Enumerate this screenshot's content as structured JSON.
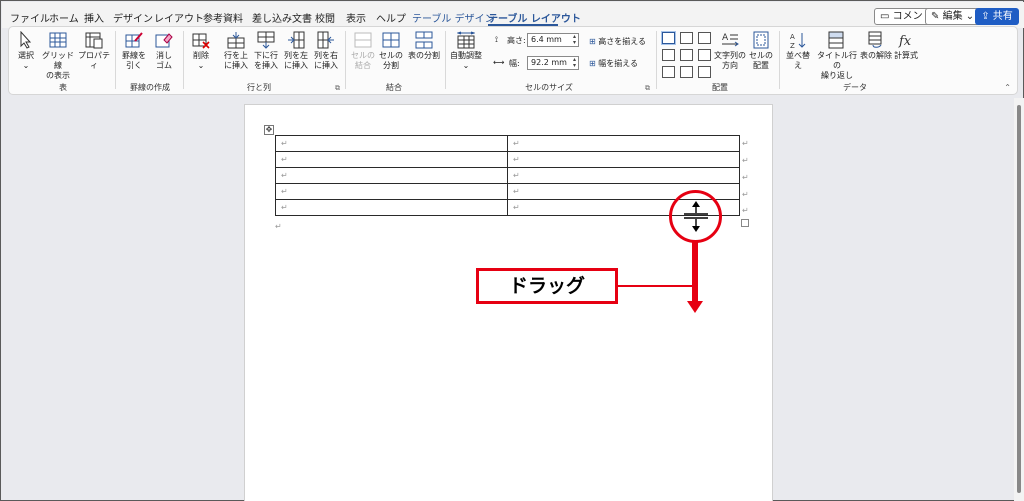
{
  "tabs": [
    "ファイル",
    "ホーム",
    "挿入",
    "デザイン",
    "レイアウト",
    "参考資料",
    "差し込み文書",
    "校閲",
    "表示",
    "ヘルプ",
    "テーブル デザイン",
    "テーブル レイアウト"
  ],
  "topbar": {
    "comment_label": "コメント",
    "edit_label": "編集",
    "share_label": "共有"
  },
  "ribbon": {
    "table_group": {
      "label": "表",
      "select": "選択",
      "gridlines": [
        "グリッド線",
        "の表示"
      ],
      "properties": "プロパティ"
    },
    "draw_group": {
      "label": "罫線の作成",
      "draw": [
        "罫線を",
        "引く"
      ],
      "eraser": [
        "消し",
        "ゴム"
      ]
    },
    "rows_cols_group": {
      "label": "行と列",
      "delete": "削除",
      "insert_above": [
        "行を上",
        "に挿入"
      ],
      "insert_below": [
        "下に行",
        "を挿入"
      ],
      "insert_left": [
        "列を左",
        "に挿入"
      ],
      "insert_right": [
        "列を右",
        "に挿入"
      ]
    },
    "merge_group": {
      "label": "結合",
      "merge_cells": [
        "セルの",
        "結合"
      ],
      "split_cells": [
        "セルの",
        "分割"
      ],
      "split_table": "表の分割"
    },
    "cell_size_group": {
      "label": "セルのサイズ",
      "autofit": "自動調整",
      "height_label": "高さ:",
      "height_value": "6.4 mm",
      "width_label": "幅:",
      "width_value": "92.2 mm",
      "distribute_rows": "高さを揃える",
      "distribute_cols": "幅を揃える"
    },
    "alignment_group": {
      "label": "配置",
      "text_direction": [
        "文字列の",
        "方向"
      ],
      "cell_margins": [
        "セルの",
        "配置"
      ]
    },
    "data_group": {
      "label": "データ",
      "sort": "並べ替え",
      "repeat_header": [
        "タイトル行の",
        "繰り返し"
      ],
      "convert": "表の解除",
      "formula": "計算式"
    }
  },
  "document": {
    "cell_mark": "↵",
    "rows": 5,
    "cols": 2
  },
  "annotation": {
    "label": "ドラッグ",
    "color": "#e60012"
  }
}
